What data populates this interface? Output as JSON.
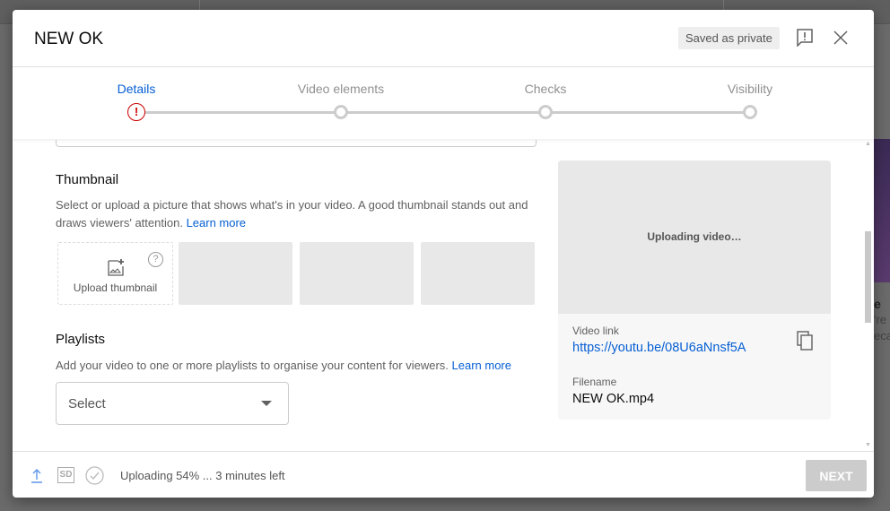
{
  "dialog": {
    "title": "NEW OK",
    "saved_badge": "Saved as private"
  },
  "steps": [
    {
      "label": "Details",
      "state": "error"
    },
    {
      "label": "Video elements",
      "state": "pending"
    },
    {
      "label": "Checks",
      "state": "pending"
    },
    {
      "label": "Visibility",
      "state": "pending"
    }
  ],
  "thumbnail": {
    "heading": "Thumbnail",
    "description": "Select or upload a picture that shows what's in your video. A good thumbnail stands out and draws viewers' attention.",
    "learn_more": "Learn more",
    "upload_label": "Upload thumbnail",
    "help_glyph": "?"
  },
  "playlists": {
    "heading": "Playlists",
    "description": "Add your video to one or more playlists to organise your content for viewers.",
    "learn_more": "Learn more",
    "select_value": "Select"
  },
  "side_panel": {
    "preview_text": "Uploading video…",
    "video_link_label": "Video link",
    "video_link": "https://youtu.be/08U6aNnsf5A",
    "filename_label": "Filename",
    "filename": "NEW OK.mp4"
  },
  "footer": {
    "status": "Uploading 54% ... 3 minutes left",
    "upload_progress_percent": 54,
    "sd_label": "SD",
    "next_label": "NEXT"
  },
  "background": {
    "text_lines": [
      "e",
      "'re",
      "ecau"
    ]
  },
  "colors": {
    "accent": "#065fd4",
    "error": "#cc0000",
    "disabled_button": "#cccccc"
  }
}
